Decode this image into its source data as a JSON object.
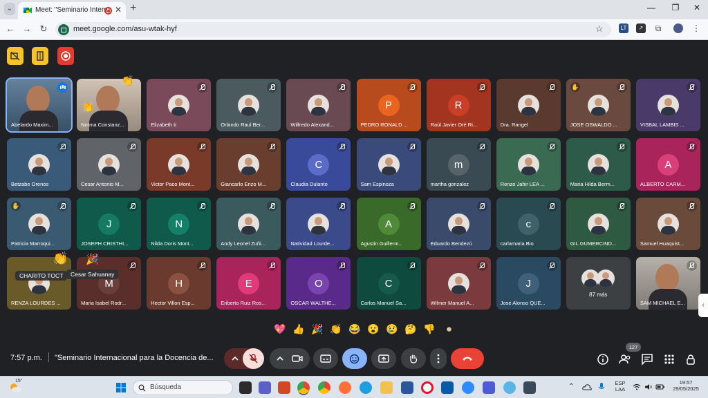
{
  "browser": {
    "tab_title": "Meet: \"Seminario Internacio",
    "url": "meet.google.com/asu-wtak-hyf",
    "new_tab_symbol": "+",
    "close_symbol": "✕",
    "window_controls": [
      "—",
      "❐",
      "✕"
    ],
    "ext_labels": [
      "LT",
      "↗"
    ]
  },
  "meet": {
    "participants": [
      {
        "name": "Abelardo Maxim...",
        "kind": "video",
        "status": "talk",
        "bg": "#4a6b8a"
      },
      {
        "name": "Norma Constanz...",
        "kind": "video",
        "status": "none",
        "bg": "#c9b8a8"
      },
      {
        "name": "Elizabeth ti",
        "kind": "photo",
        "status": "mute",
        "bg": "#7a4a5a"
      },
      {
        "name": "Orlando Raul Ber...",
        "kind": "photo",
        "status": "mute",
        "bg": "#4a5a5e"
      },
      {
        "name": "Wilfredo Alexand...",
        "kind": "photo",
        "status": "mute",
        "bg": "#6a4a52"
      },
      {
        "name": "PEDRO RONALD ...",
        "kind": "letter",
        "letter": "P",
        "status": "mute",
        "bg": "#b84b1e",
        "avatar": "#e8651f"
      },
      {
        "name": "Raúl Javier Oré Ri...",
        "kind": "letter",
        "letter": "R",
        "status": "mute",
        "bg": "#a3341f",
        "avatar": "#c93f26"
      },
      {
        "name": "Dra. Rangel",
        "kind": "photo",
        "status": "mute",
        "bg": "#5a3a2e"
      },
      {
        "name": "JOSE OSWALDO ...",
        "kind": "photo",
        "status": "mute",
        "bg": "#6a4a3e",
        "hand": true
      },
      {
        "name": "VISBAL LAMBIS ...",
        "kind": "photo",
        "status": "mute",
        "bg": "#4a3a6a"
      },
      {
        "name": "Betzabe Orenos",
        "kind": "photo",
        "status": "mute",
        "bg": "#3a5a7a"
      },
      {
        "name": "Cesar Antonio M...",
        "kind": "photo",
        "status": "mute",
        "bg": "#606468"
      },
      {
        "name": "Victor Paco Mont...",
        "kind": "photo",
        "status": "mute",
        "bg": "#7a3a2a"
      },
      {
        "name": "Giancarlo Enzo M...",
        "kind": "photo",
        "status": "mute",
        "bg": "#6a3e2e"
      },
      {
        "name": "Claudia Dulanto",
        "kind": "letter",
        "letter": "C",
        "status": "mute",
        "bg": "#3a4a9a",
        "avatar": "#5b6bc8"
      },
      {
        "name": "Sam Espinoza",
        "kind": "photo",
        "status": "mute",
        "bg": "#3a4a7a"
      },
      {
        "name": "martha gonzalez",
        "kind": "letter",
        "letter": "m",
        "status": "mute",
        "bg": "#3a4a52",
        "avatar": "#56636b"
      },
      {
        "name": "Renzo Jahir LEA ...",
        "kind": "photo",
        "status": "mute",
        "bg": "#3a6a52"
      },
      {
        "name": "Maria Hilda Berm...",
        "kind": "photo",
        "status": "mute",
        "bg": "#2e5a4a"
      },
      {
        "name": "ALBERTO CARM...",
        "kind": "letter",
        "letter": "A",
        "status": "mute",
        "bg": "#a8245a",
        "avatar": "#d9407a"
      },
      {
        "name": "Patricia Marroqui...",
        "kind": "photo",
        "status": "mute",
        "bg": "#3a5a72",
        "hand": true
      },
      {
        "name": "JOSEPH CRISTHI...",
        "kind": "letter",
        "letter": "J",
        "status": "mute",
        "bg": "#0f5a4a",
        "avatar": "#157a62"
      },
      {
        "name": "Nilda Doris Mont...",
        "kind": "letter",
        "letter": "N",
        "status": "mute",
        "bg": "#0f5a4a",
        "avatar": "#15806a"
      },
      {
        "name": "Andy Leonel Zuñi...",
        "kind": "photo",
        "status": "mute",
        "bg": "#3a5a5e"
      },
      {
        "name": "Natividad Lourde...",
        "kind": "photo",
        "status": "mute",
        "bg": "#3a4a8a"
      },
      {
        "name": "Agustin Guillerm...",
        "kind": "letter",
        "letter": "A",
        "status": "mute",
        "bg": "#3a6a2a",
        "avatar": "#4f8a38"
      },
      {
        "name": "Eduardo Bendezú",
        "kind": "photo",
        "status": "mute",
        "bg": "#3a4a6a"
      },
      {
        "name": "carlamaria Bio",
        "kind": "letter",
        "letter": "c",
        "status": "mute",
        "bg": "#2a4a52",
        "avatar": "#40606a"
      },
      {
        "name": "GIL GUMERCIND...",
        "kind": "photo",
        "status": "mute",
        "bg": "#2e5a42"
      },
      {
        "name": "Samuel Huaquist...",
        "kind": "photo",
        "status": "mute",
        "bg": "#6a4a3a"
      },
      {
        "name": "RENZA LOURDES ...",
        "kind": "photo",
        "status": "none",
        "bg": "#6a5a2a"
      },
      {
        "name": "Maria Isabel Rodr...",
        "kind": "letter",
        "letter": "M",
        "status": "mute",
        "bg": "#5a2e2a",
        "avatar": "#6a3e3a"
      },
      {
        "name": "Hector Villon Esp...",
        "kind": "letter",
        "letter": "H",
        "status": "mute",
        "bg": "#6a3a2e",
        "avatar": "#8a5040"
      },
      {
        "name": "Eriberto Ruiz Ros...",
        "kind": "letter",
        "letter": "E",
        "status": "mute",
        "bg": "#a8245a",
        "avatar": "#e03a7a"
      },
      {
        "name": "OSCAR WALTHE...",
        "kind": "letter",
        "letter": "O",
        "status": "mute",
        "bg": "#5a2a8a",
        "avatar": "#7a44b0"
      },
      {
        "name": "Carlos Manuel Sa...",
        "kind": "letter",
        "letter": "C",
        "status": "mute",
        "bg": "#0f4a3e",
        "avatar": "#155a4a"
      },
      {
        "name": "Wilmer Manuel A...",
        "kind": "photo",
        "status": "mute",
        "bg": "#7a3a3e"
      },
      {
        "name": "Jose Alonso QUE...",
        "kind": "letter",
        "letter": "J",
        "status": "mute",
        "bg": "#2a4a62",
        "avatar": "#40607a"
      },
      {
        "name": "87 más",
        "kind": "more",
        "status": "none",
        "bg": "#3c4043"
      },
      {
        "name": "SAM MICHAEL E...",
        "kind": "video",
        "status": "mute",
        "bg": "#a8a29a"
      }
    ],
    "floating_labels": [
      "CHARITO TOCT",
      "Cesar Sahuanay"
    ],
    "reactions": [
      "💖",
      "👍",
      "🎉",
      "👏",
      "😂",
      "😮",
      "😢",
      "🤔",
      "👎",
      "⏺"
    ],
    "time": "7:57 p.m.",
    "meeting_title": "\"Seminario Internacional para la Docencia de...",
    "people_count": "127",
    "colors": {
      "end_call": "#ea4335",
      "accent_blue": "#8ab4f8",
      "badge_yellow": "#f7c22e",
      "mic_off_bg": "#f9dedc"
    }
  },
  "taskbar": {
    "temp": "15°",
    "search_placeholder": "Búsqueda",
    "lang_top": "ESP",
    "lang_bottom": "LAA",
    "clock_time": "19:57",
    "clock_date": "29/05/2025"
  }
}
